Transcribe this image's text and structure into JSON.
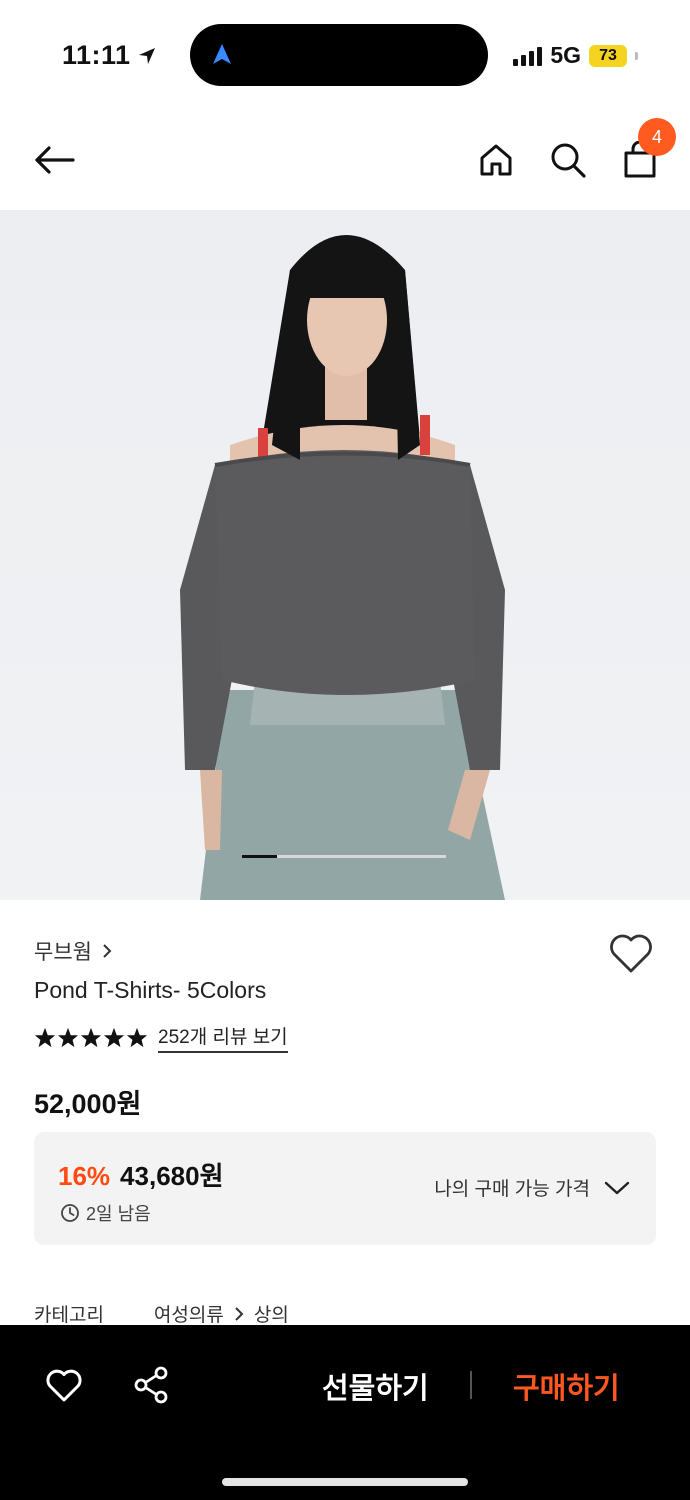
{
  "status": {
    "time": "11:11",
    "network": "5G",
    "battery": "73"
  },
  "header": {
    "cart_count": "4"
  },
  "gallery": {
    "progress": 0.17
  },
  "product": {
    "brand": "무브웜",
    "title": "Pond T-Shirts- 5Colors",
    "rating_stars": 5,
    "reviews_link": "252개 리뷰 보기",
    "price": "52,000원",
    "discount": "16%",
    "discount_price": "43,680원",
    "time_left": "2일 남음",
    "my_price_label": "나의 구매 가능 가격",
    "category_label": "카테고리",
    "category_path": [
      "여성의류",
      "상의"
    ]
  },
  "bottom": {
    "gift_label": "선물하기",
    "buy_label": "구매하기"
  },
  "colors": {
    "accent": "#ff4b12",
    "badge": "#ff5a1f",
    "buy": "#ff5722"
  }
}
